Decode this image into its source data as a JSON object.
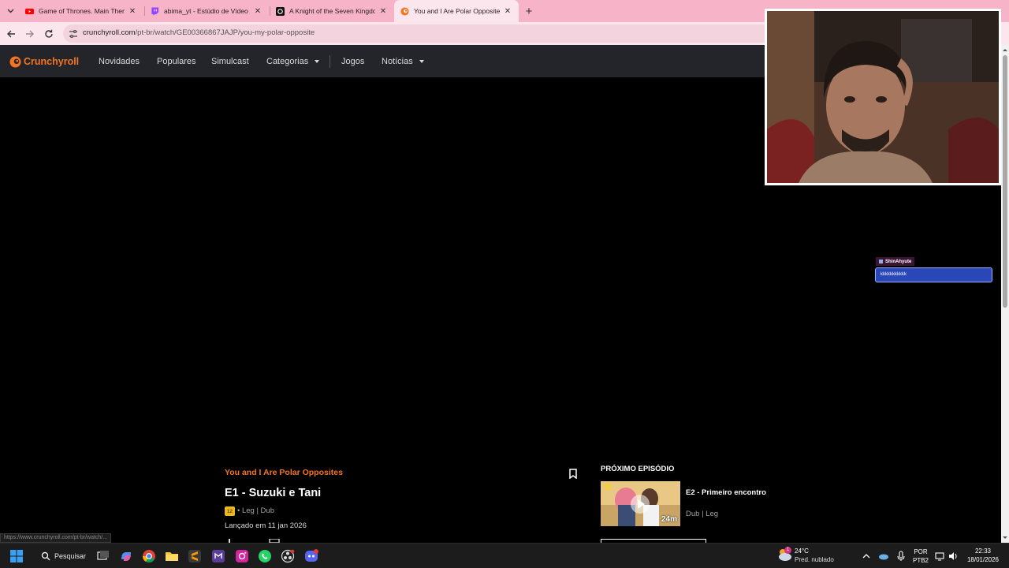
{
  "browser": {
    "tabs": [
      {
        "title": "Game of Thrones. Main Theme",
        "icon": "youtube-icon"
      },
      {
        "title": "abima_yt - Estúdio de Vídeo - T",
        "icon": "twitch-icon"
      },
      {
        "title": "A Knight of the Seven Kingdoms",
        "icon": "hbo-icon"
      },
      {
        "title": "You and I Are Polar Opposites",
        "icon": "crunchyroll-icon",
        "active": true
      }
    ],
    "url_domain": "crunchyroll.com",
    "url_path": "/pt-br/watch/GE00366867JAJP/you-my-polar-opposite",
    "status_url": "https://www.crunchyroll.com/pt-br/watch/..."
  },
  "site": {
    "logo": "Crunchyroll",
    "brand_color": "#f47521",
    "nav": [
      {
        "label": "Novidades"
      },
      {
        "label": "Populares"
      },
      {
        "label": "Simulcast"
      },
      {
        "label": "Categorias",
        "dropdown": true
      },
      {
        "label": "Jogos"
      },
      {
        "label": "Notícias",
        "dropdown": true
      }
    ]
  },
  "chat": {
    "username": "ShinAhyute",
    "message": "kkkkkkkkkkk"
  },
  "episode": {
    "series": "You and I Are Polar Opposites",
    "title": "E1 - Suzuki e Tani",
    "rating": "12",
    "languages": "• Leg | Dub",
    "release": "Lançado em 11 jan 2026"
  },
  "next_episode": {
    "label": "PRÓXIMO EPISÓDIO",
    "title": "E2 - Primeiro encontro",
    "duration": "24m",
    "languages": "Dub | Leg"
  },
  "taskbar": {
    "search_label": "Pesquisar",
    "temperature": "24°C",
    "weather": "Pred. nublado",
    "language": "POR",
    "layout": "PTB2",
    "time": "22:33",
    "date": "18/01/2026",
    "weather_badge": "1"
  }
}
